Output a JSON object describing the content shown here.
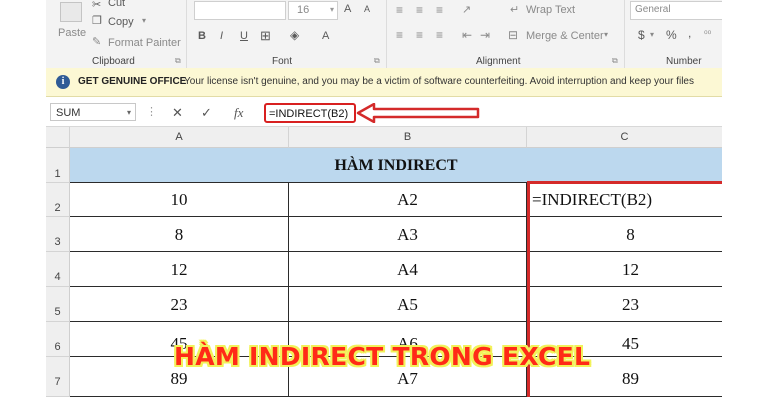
{
  "ribbon": {
    "clipboard": {
      "paste": "Paste",
      "cut": "Cut",
      "copy": "Copy",
      "format_painter": "Format Painter",
      "group_label": "Clipboard"
    },
    "font": {
      "size": "16",
      "grow": "A",
      "shrink": "A",
      "bold": "B",
      "italic": "I",
      "underline": "U",
      "font_color": "A",
      "group_label": "Font"
    },
    "alignment": {
      "wrap_text": "Wrap Text",
      "merge_center": "Merge & Center",
      "group_label": "Alignment"
    },
    "number": {
      "format": "General",
      "currency": "$",
      "percent": "%",
      "comma": ",",
      "group_label": "Number"
    }
  },
  "infobar": {
    "icon": "info-icon",
    "title": "GET GENUINE OFFICE",
    "message": "Your license isn't genuine, and you may be a victim of software counterfeiting. Avoid interruption and keep your files"
  },
  "formula_bar": {
    "name_box": "SUM",
    "cancel": "✕",
    "enter": "✓",
    "fx": "fx",
    "formula": "=INDIRECT(B2)"
  },
  "sheet": {
    "columns": [
      "A",
      "B",
      "C"
    ],
    "rows": [
      "1",
      "2",
      "3",
      "4",
      "5",
      "6",
      "7"
    ],
    "title": "HÀM INDIRECT",
    "data": [
      {
        "a": "10",
        "b": "A2",
        "c": "=INDIRECT(B2)"
      },
      {
        "a": "8",
        "b": "A3",
        "c": "8"
      },
      {
        "a": "12",
        "b": "A4",
        "c": "12"
      },
      {
        "a": "23",
        "b": "A5",
        "c": "23"
      },
      {
        "a": "45",
        "b": "A6",
        "c": "45"
      },
      {
        "a": "89",
        "b": "A7",
        "c": "89"
      }
    ]
  },
  "overlay_caption": "HÀM INDIRECT TRONG EXCEL",
  "colors": {
    "accent_red": "#d42a2a",
    "title_fill": "#bcd8ee",
    "caption": "#ff2a17",
    "caption_outline": "#f2f25a"
  }
}
